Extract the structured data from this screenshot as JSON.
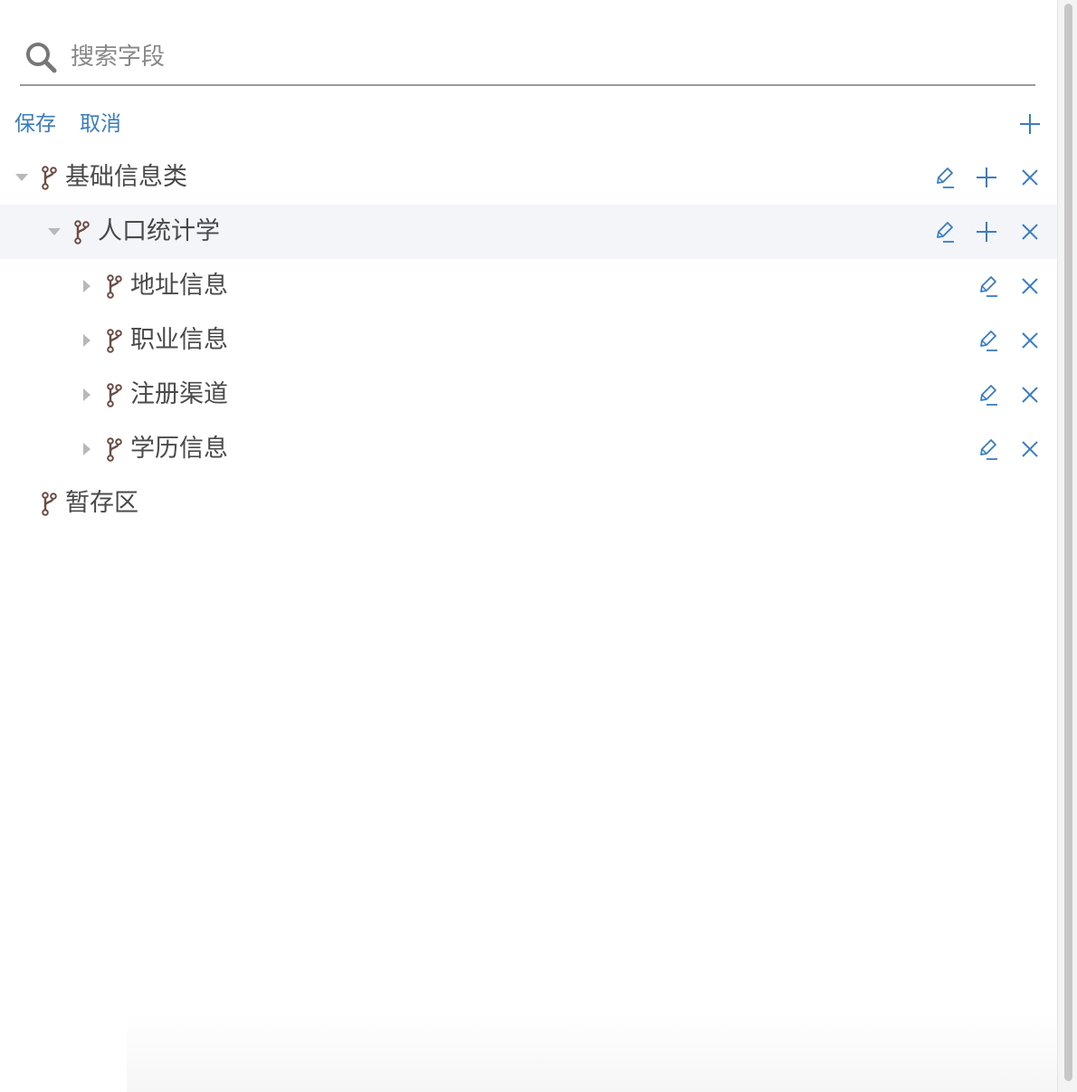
{
  "search": {
    "placeholder": "搜索字段"
  },
  "toolbar": {
    "save_label": "保存",
    "cancel_label": "取消"
  },
  "tree": {
    "nodes": [
      {
        "label": "基础信息类",
        "level": 0,
        "expanded": true
      },
      {
        "label": "人口统计学",
        "level": 1,
        "expanded": true,
        "highlighted": true
      },
      {
        "label": "地址信息",
        "level": 2,
        "expanded": false
      },
      {
        "label": "职业信息",
        "level": 2,
        "expanded": false
      },
      {
        "label": "注册渠道",
        "level": 2,
        "expanded": false
      },
      {
        "label": "学历信息",
        "level": 2,
        "expanded": false
      },
      {
        "label": "暂存区",
        "level": 0,
        "leaf": true
      }
    ]
  },
  "icons": {
    "search": "search-icon",
    "branch": "branch-icon",
    "edit": "pencil-icon",
    "add": "plus-icon",
    "delete": "close-icon",
    "expand": "caret-icon"
  },
  "colors": {
    "accent": "#3a7cc0",
    "branch_icon": "#6b4c44",
    "text": "#4a4a4a",
    "highlight_row": "#f3f5f8",
    "caret": "#b8b8b8"
  }
}
